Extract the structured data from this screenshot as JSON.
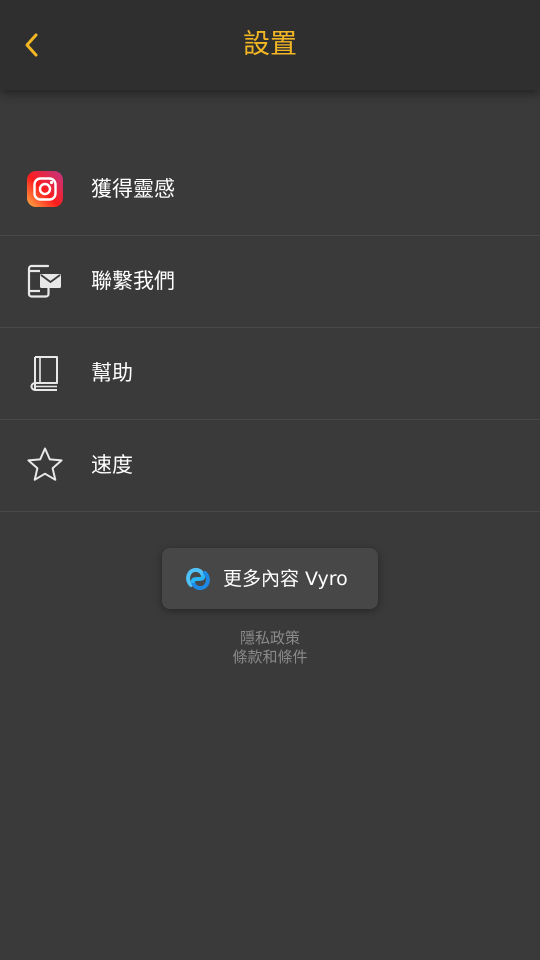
{
  "header": {
    "back_icon": "chevron-left-icon",
    "title": "設置",
    "accent_color": "#f4b724"
  },
  "menu": {
    "items": [
      {
        "label": "獲得靈感",
        "icon": "instagram-icon"
      },
      {
        "label": "聯繫我們",
        "icon": "phone-mail-icon"
      },
      {
        "label": "幫助",
        "icon": "book-icon"
      },
      {
        "label": "速度",
        "icon": "star-icon"
      }
    ]
  },
  "more_button": {
    "label": "更多內容 Vyro",
    "icon": "vyro-logo-icon"
  },
  "footer": {
    "privacy_label": "隱私政策",
    "terms_label": "條款和條件"
  },
  "colors": {
    "background": "#3a3a3a",
    "header_background": "#2f2f2f",
    "footer_text": "#8a8a8a"
  }
}
